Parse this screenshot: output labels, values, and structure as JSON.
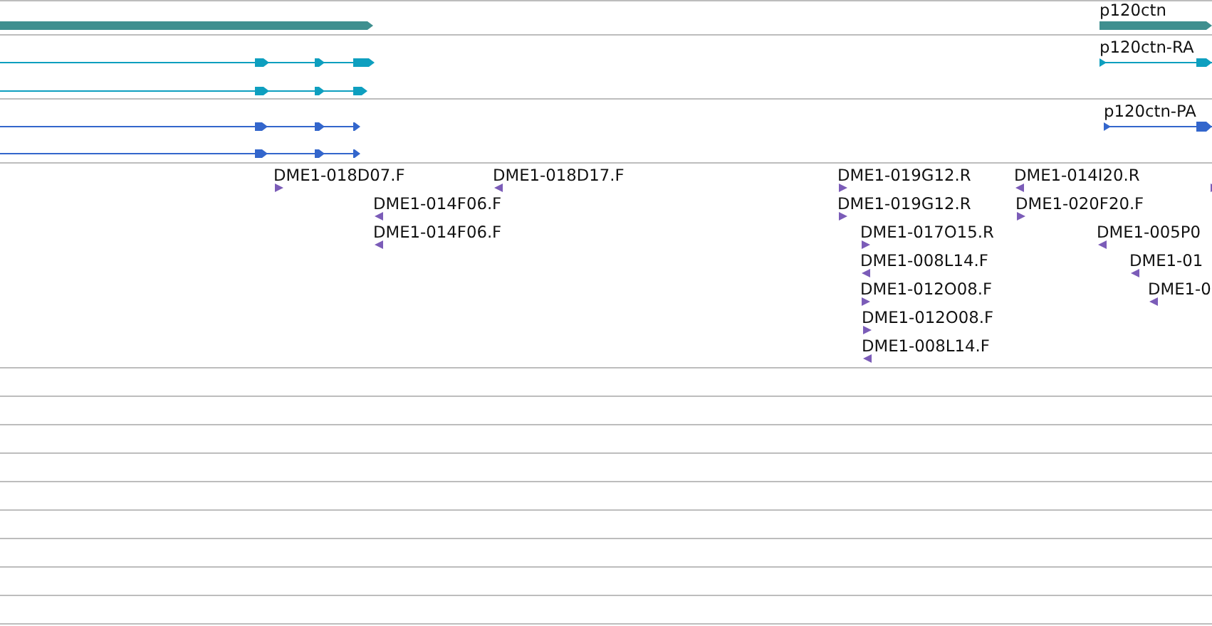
{
  "tracks": [
    {
      "kind": "gene",
      "features": [
        {
          "kind": "gene"
        },
        {
          "kind": "gene",
          "label": "p120ctn"
        }
      ]
    },
    {
      "kind": "transcript",
      "features": [
        {
          "kind": "transcript"
        },
        {
          "kind": "transcript"
        },
        {
          "kind": "transcript",
          "label": "p120ctn-RA"
        }
      ]
    },
    {
      "kind": "protein",
      "features": [
        {
          "kind": "protein"
        },
        {
          "kind": "protein"
        },
        {
          "kind": "protein",
          "label": "p120ctn-PA"
        }
      ]
    },
    {
      "kind": "est",
      "features": [
        {
          "label": "DME1-018D07.F",
          "reverse": false
        },
        {
          "label": "DME1-018D17.F",
          "reverse": true
        },
        {
          "label": "DME1-014F06.F",
          "reverse": true
        },
        {
          "label": "DME1-014F06.F",
          "reverse": true
        },
        {
          "label": "DME1-019G12.R",
          "reverse": false
        },
        {
          "label": "DME1-019G12.R",
          "reverse": false
        },
        {
          "label": "DME1-017O15.R",
          "reverse": false
        },
        {
          "label": "DME1-008L14.F",
          "reverse": true
        },
        {
          "label": "DME1-012O08.F",
          "reverse": false
        },
        {
          "label": "DME1-012O08.F",
          "reverse": false
        },
        {
          "label": "DME1-008L14.F",
          "reverse": true
        },
        {
          "label": "DME1-014I20.R",
          "reverse": true
        },
        {
          "label": "DME1-020F20.F",
          "reverse": false
        },
        {
          "label": "DME1-005P0",
          "reverse": true
        },
        {
          "label": "DME1-01",
          "reverse": true
        },
        {
          "label": "DME1-0",
          "reverse": true
        },
        {
          "reverse": false
        }
      ]
    }
  ]
}
